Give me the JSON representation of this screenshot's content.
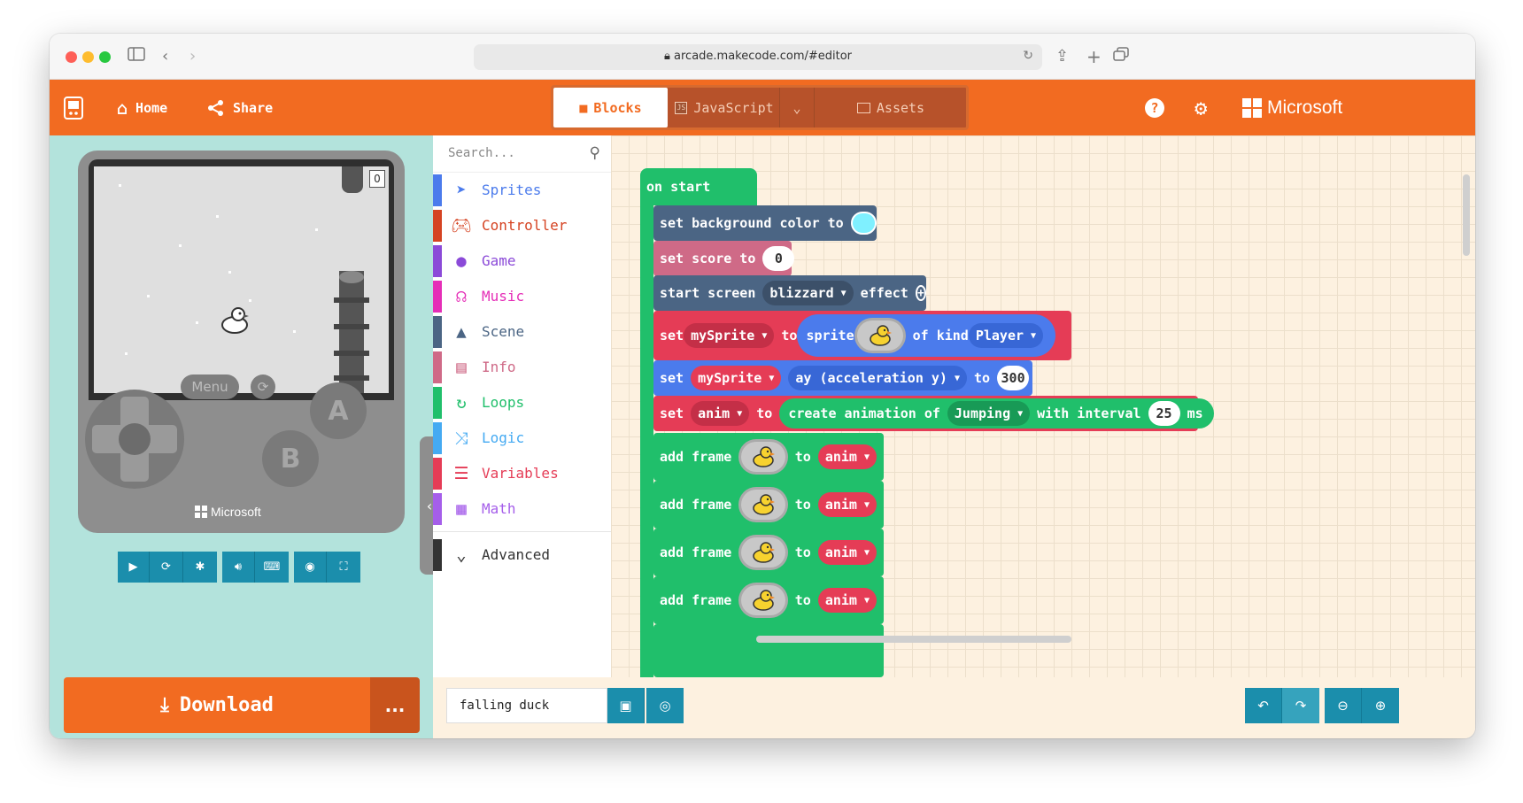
{
  "browser": {
    "url": "arcade.makecode.com/#editor"
  },
  "toolbar": {
    "home_label": "Home",
    "share_label": "Share",
    "tabs": [
      {
        "label": "Blocks",
        "active": true
      },
      {
        "label": "JavaScript",
        "active": false
      },
      {
        "label": "Assets",
        "active": false
      }
    ],
    "brand": "Microsoft",
    "colors": {
      "accent": "#f26b21"
    }
  },
  "simulator": {
    "score": "0",
    "menu_label": "Menu",
    "button_a": "A",
    "button_b": "B",
    "console_brand": "Microsoft",
    "download_label": "Download",
    "more_label": "..."
  },
  "toolbox": {
    "search_placeholder": "Search...",
    "categories": [
      {
        "label": "Sprites",
        "color": "#4b7bec",
        "icon": "paper-plane-icon"
      },
      {
        "label": "Controller",
        "color": "#d54322",
        "icon": "gamepad-icon"
      },
      {
        "label": "Game",
        "color": "#8b4ad8",
        "icon": "circle-icon"
      },
      {
        "label": "Music",
        "color": "#e52eb7",
        "icon": "headphones-icon"
      },
      {
        "label": "Scene",
        "color": "#4b6584",
        "icon": "tree-icon"
      },
      {
        "label": "Info",
        "color": "#cf6a87",
        "icon": "id-card-icon"
      },
      {
        "label": "Loops",
        "color": "#20bf6b",
        "icon": "loop-icon"
      },
      {
        "label": "Logic",
        "color": "#45aaf2",
        "icon": "shuffle-icon"
      },
      {
        "label": "Variables",
        "color": "#e53c56",
        "icon": "list-icon"
      },
      {
        "label": "Math",
        "color": "#a55eea",
        "icon": "calculator-icon"
      }
    ],
    "advanced_label": "Advanced"
  },
  "workspace": {
    "on_start": "on start",
    "blocks": {
      "bg": {
        "text": "set background color to",
        "color_value": "#7ff0ff"
      },
      "score": {
        "text": "set score to",
        "value": "0"
      },
      "effect": {
        "pre": "start screen",
        "effect": "blizzard",
        "post": "effect"
      },
      "sprite": {
        "set": "set",
        "var": "mySprite",
        "to": "to",
        "sprite": "sprite",
        "of_kind": "of kind",
        "kind": "Player"
      },
      "accel": {
        "set": "set",
        "var": "mySprite",
        "prop": "ay (acceleration y)",
        "to": "to",
        "value": "300"
      },
      "anim": {
        "set": "set",
        "var": "anim",
        "to": "to",
        "create": "create animation of",
        "action": "Jumping",
        "interval_text": "with interval",
        "interval": "25",
        "unit": "ms"
      },
      "frames": [
        {
          "add": "add frame",
          "to": "to",
          "var": "anim"
        },
        {
          "add": "add frame",
          "to": "to",
          "var": "anim"
        },
        {
          "add": "add frame",
          "to": "to",
          "var": "anim"
        },
        {
          "add": "add frame",
          "to": "to",
          "var": "anim"
        }
      ]
    }
  },
  "editor_bar": {
    "project_name": "falling duck"
  }
}
